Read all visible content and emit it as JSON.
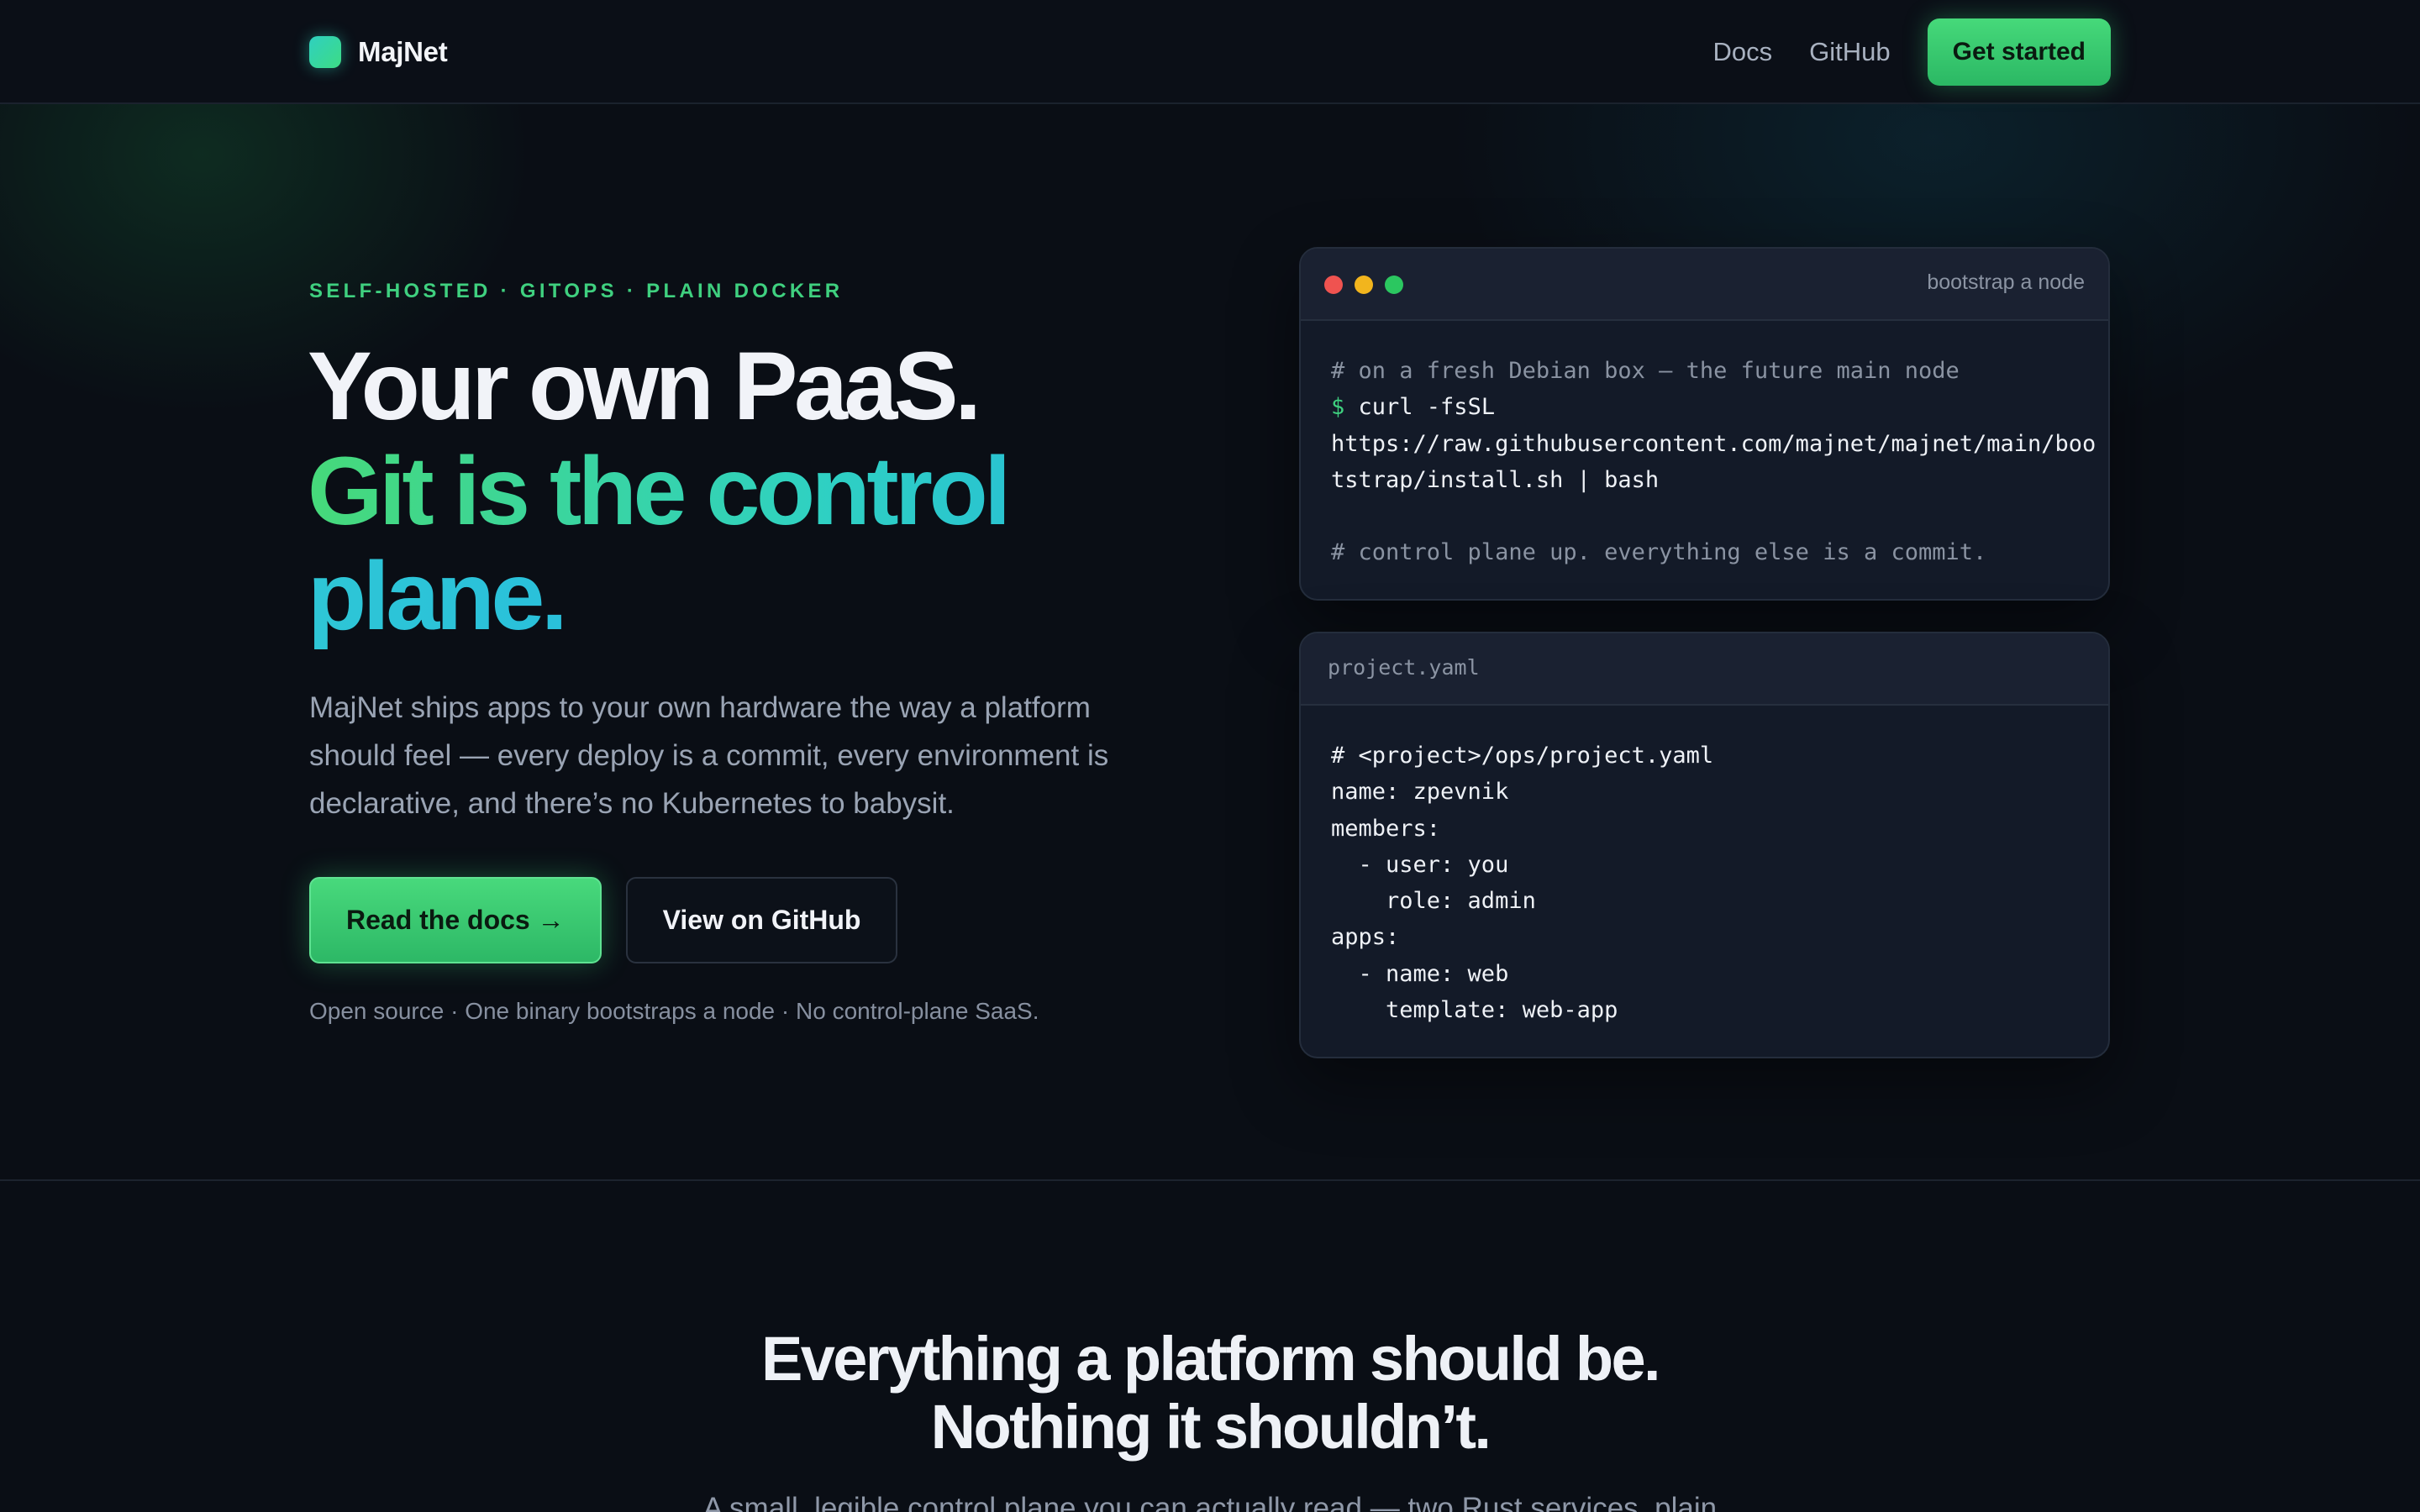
{
  "nav": {
    "brand": "MajNet",
    "links": [
      "Docs",
      "GitHub"
    ],
    "cta": "Get started"
  },
  "hero": {
    "eyebrow": "SELF-HOSTED · GITOPS · PLAIN DOCKER",
    "headline_line1": "Your own PaaS.",
    "headline_line2": "Git is the control",
    "headline_line3": "plane.",
    "lede": "MajNet ships apps to your own hardware the way a platform should feel — every deploy is a commit, every environment is declarative, and there’s no Kubernetes to babysit.",
    "primary_cta": "Read the docs →",
    "secondary_cta": "View on GitHub",
    "fineprint": "Open source · One binary bootstraps a node · No control-plane SaaS."
  },
  "bootstrap_card": {
    "title": "bootstrap a node",
    "comment1": "# on a fresh Debian box — the future main node",
    "prompt": "$",
    "command": " curl -fsSL",
    "url_line1": "https://raw.githubusercontent.com/majnet/majnet/main/boo",
    "url_line2": "tstrap/install.sh | bash",
    "comment2": "# control plane up. everything else is a commit."
  },
  "project_card": {
    "title": "project.yaml",
    "lines": [
      "# <project>/ops/project.yaml",
      "name: zpevnik",
      "members:",
      "  - user: you",
      "    role: admin",
      "apps:",
      "  - name: web",
      "    template: web-app"
    ]
  },
  "section2": {
    "heading_line1": "Everything a platform should be.",
    "heading_line2": "Nothing it shouldn’t.",
    "subheading": "A small, legible control plane you can actually read — two Rust services, plain"
  },
  "colors": {
    "background": "#0a0e15",
    "accent_green": "#3fd07f",
    "accent_cyan": "#22b4e0",
    "card_bg": "#131a28"
  }
}
